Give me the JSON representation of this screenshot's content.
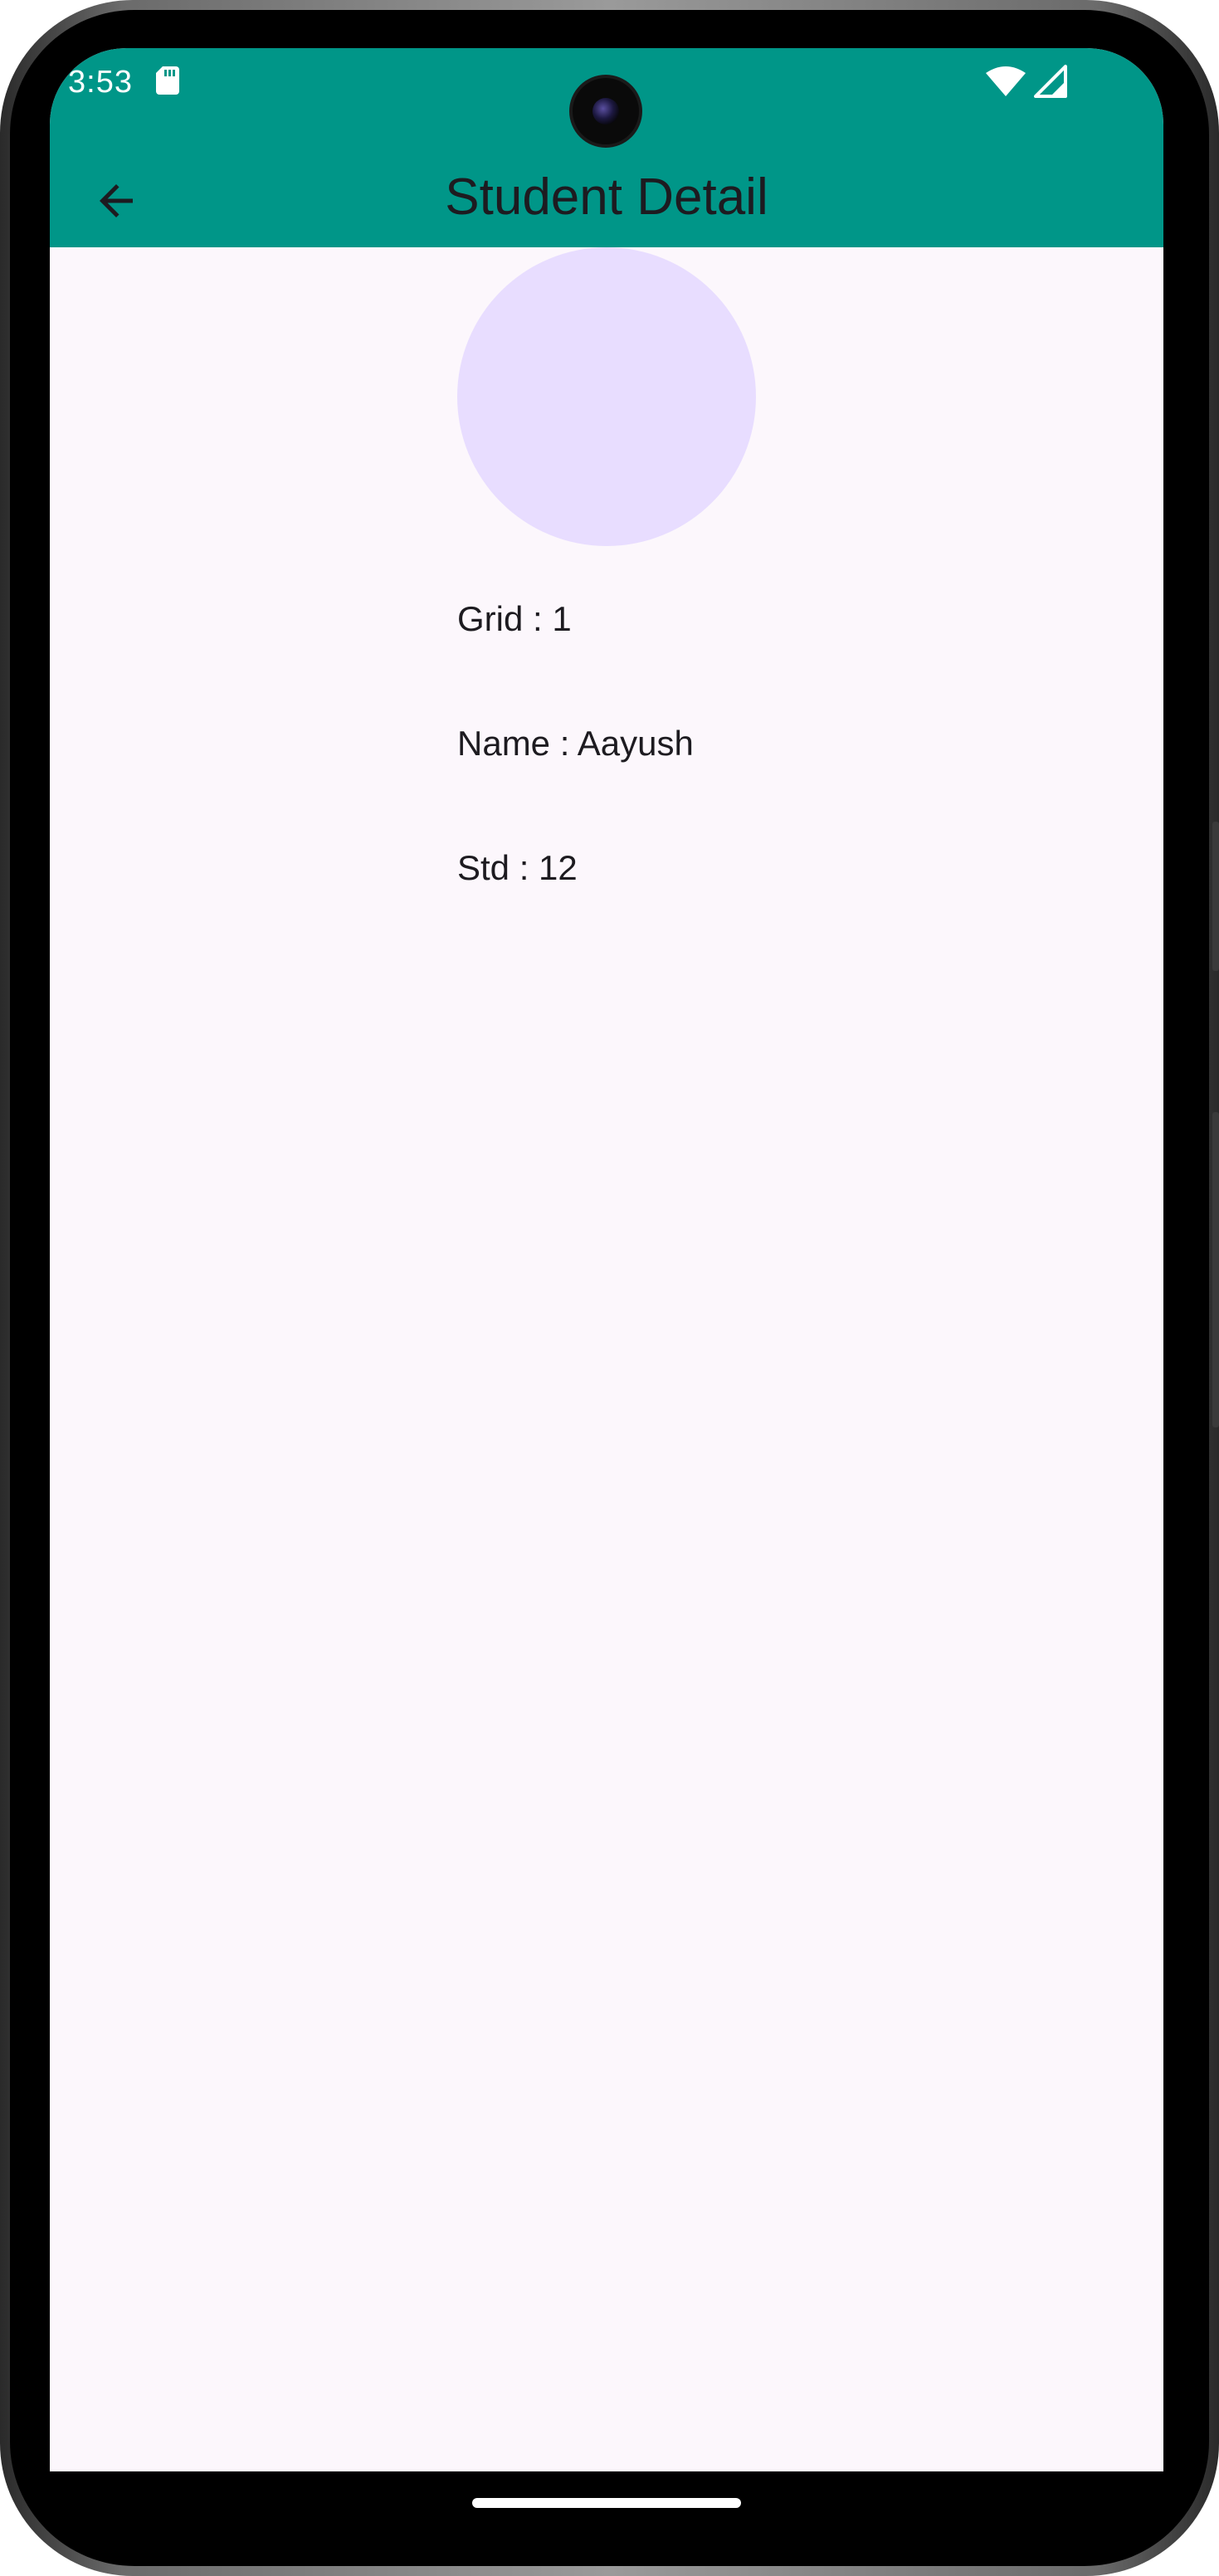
{
  "status_bar": {
    "time": "3:53",
    "icons": [
      "sd-card-icon",
      "wifi-icon",
      "cellular-signal-icon"
    ]
  },
  "app_bar": {
    "title": "Student Detail",
    "back_icon": "arrow-back-icon",
    "color": "#009688"
  },
  "student": {
    "grid_text": "Grid : 1",
    "name_text": "Name : Aayush",
    "std_text": "Std : 12",
    "avatar_color": "#e8ddff"
  },
  "colors": {
    "background": "#fcf7fc",
    "text": "#1d1b20"
  }
}
